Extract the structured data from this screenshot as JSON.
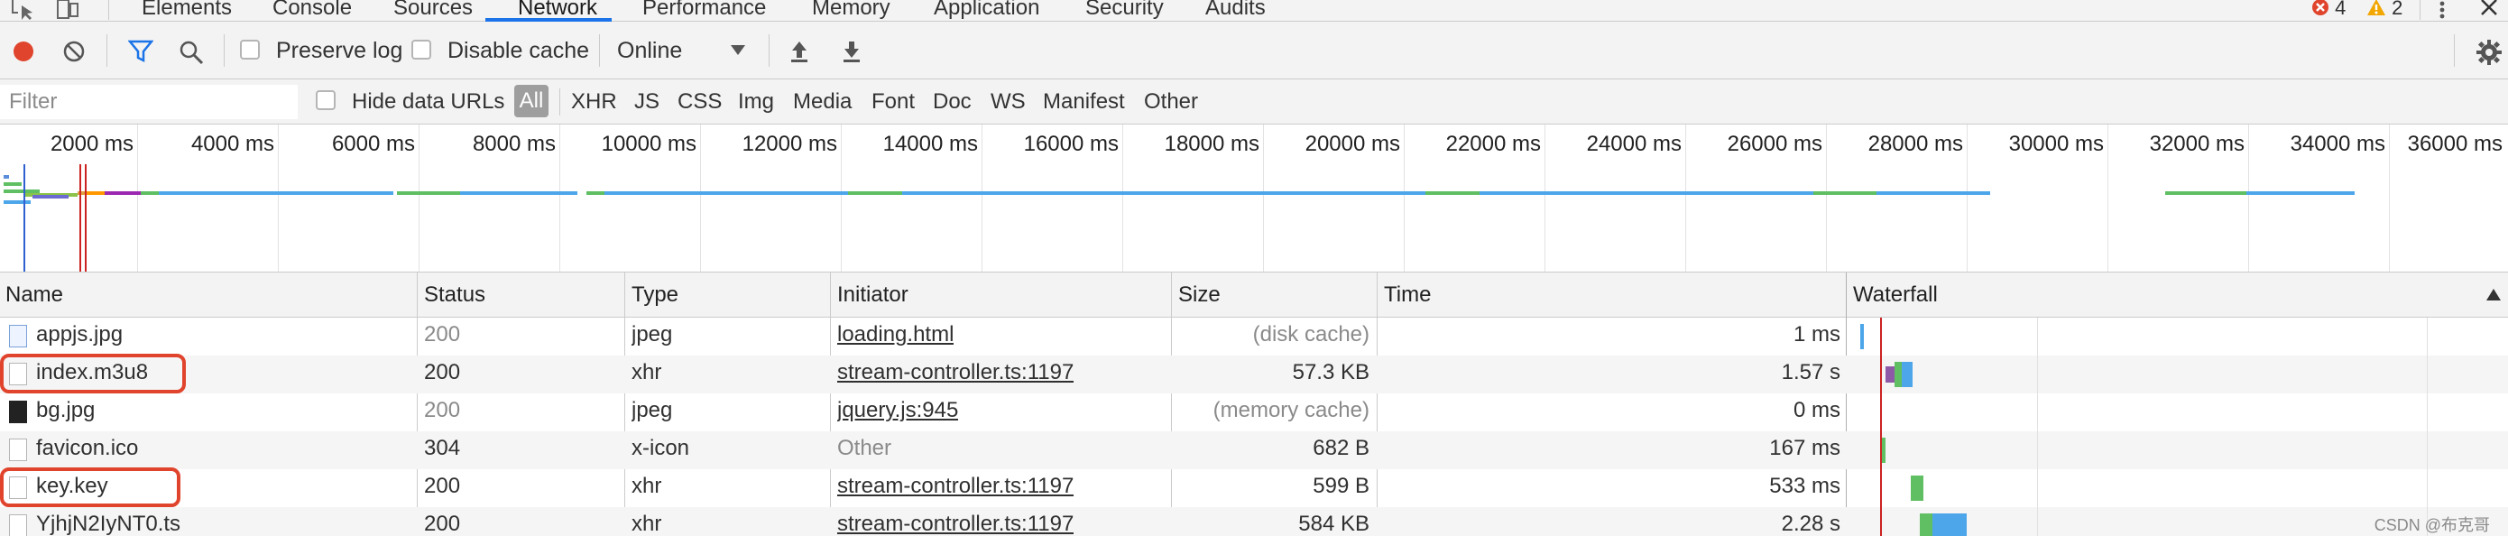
{
  "tabs": [
    {
      "label": "Elements"
    },
    {
      "label": "Console"
    },
    {
      "label": "Sources"
    },
    {
      "label": "Network"
    },
    {
      "label": "Performance"
    },
    {
      "label": "Memory"
    },
    {
      "label": "Application"
    },
    {
      "label": "Security"
    },
    {
      "label": "Audits"
    }
  ],
  "badges": {
    "errors": "4",
    "warnings": "2"
  },
  "toolbar": {
    "preserve_log": "Preserve log",
    "disable_cache": "Disable cache",
    "throttle": "Online",
    "colors": {
      "record": "#e0442c",
      "filter_active": "#1a73e8"
    }
  },
  "filterbar": {
    "placeholder": "Filter",
    "hide_data_urls": "Hide data URLs",
    "types": [
      "All",
      "XHR",
      "JS",
      "CSS",
      "Img",
      "Media",
      "Font",
      "Doc",
      "WS",
      "Manifest",
      "Other"
    ]
  },
  "overview": {
    "ticks": [
      "2000 ms",
      "4000 ms",
      "6000 ms",
      "8000 ms",
      "10000 ms",
      "12000 ms",
      "14000 ms",
      "16000 ms",
      "18000 ms",
      "20000 ms",
      "22000 ms",
      "24000 ms",
      "26000 ms",
      "28000 ms",
      "30000 ms",
      "32000 ms",
      "34000 ms",
      "36000 ms"
    ]
  },
  "columns": [
    "Name",
    "Status",
    "Type",
    "Initiator",
    "Size",
    "Time",
    "Waterfall"
  ],
  "rows": [
    {
      "name": "appjs.jpg",
      "status": "200",
      "type": "jpeg",
      "initiator": "loading.html",
      "size": "(disk cache)",
      "time": "1 ms",
      "icon": "image-file-icon",
      "status_dim": true,
      "size_dim": true,
      "initiator_link": true
    },
    {
      "name": "index.m3u8",
      "status": "200",
      "type": "xhr",
      "initiator": "stream-controller.ts:1197",
      "size": "57.3 KB",
      "time": "1.57 s",
      "icon": "document-file-icon",
      "status_dim": false,
      "size_dim": false,
      "initiator_link": true,
      "highlighted": true
    },
    {
      "name": "bg.jpg",
      "status": "200",
      "type": "jpeg",
      "initiator": "jquery.js:945",
      "size": "(memory cache)",
      "time": "0 ms",
      "icon": "image-file-icon",
      "status_dim": true,
      "size_dim": true,
      "initiator_link": true
    },
    {
      "name": "favicon.ico",
      "status": "304",
      "type": "x-icon",
      "initiator": "Other",
      "size": "682 B",
      "time": "167 ms",
      "icon": "document-file-icon",
      "status_dim": false,
      "size_dim": false,
      "initiator_link": false
    },
    {
      "name": "key.key",
      "status": "200",
      "type": "xhr",
      "initiator": "stream-controller.ts:1197",
      "size": "599 B",
      "time": "533 ms",
      "icon": "document-file-icon",
      "status_dim": false,
      "size_dim": false,
      "initiator_link": true,
      "highlighted": true
    },
    {
      "name": "YjhjN2IyNT0.ts",
      "status": "200",
      "type": "xhr",
      "initiator": "stream-controller.ts:1197",
      "size": "584 KB",
      "time": "2.28 s",
      "icon": "document-file-icon",
      "status_dim": false,
      "size_dim": false,
      "initiator_link": true
    }
  ],
  "watermark": "CSDN @布克哥"
}
